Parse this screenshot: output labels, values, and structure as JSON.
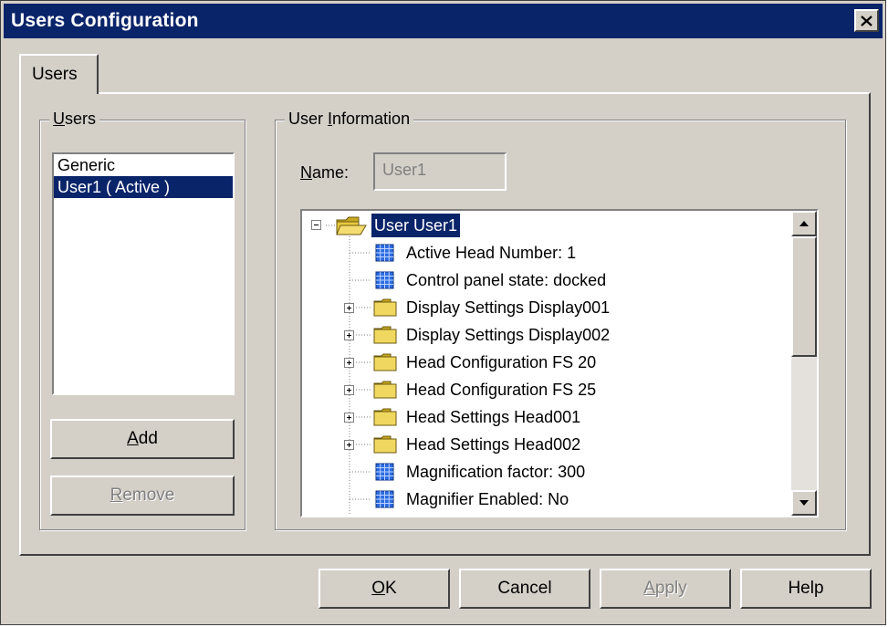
{
  "window": {
    "title": "Users Configuration"
  },
  "tabs": [
    {
      "label": "Users",
      "active": true
    }
  ],
  "users_group": {
    "label_mnemonic": "U",
    "label_rest": "sers",
    "items": [
      {
        "label": "Generic",
        "selected": false
      },
      {
        "label": "User1 ( Active )",
        "selected": true
      }
    ],
    "add_mnemonic": "A",
    "add_rest": "dd",
    "remove_mnemonic": "R",
    "remove_rest": "emove"
  },
  "user_info": {
    "label_pre": "User ",
    "label_mnemonic": "I",
    "label_rest": "nformation",
    "name_label_mnemonic": "N",
    "name_label_rest": "ame:",
    "name_value": "User1"
  },
  "tree": {
    "root": "User User1",
    "items": [
      {
        "label": "Active Head Number: 1",
        "icon": "setting-icon",
        "expandable": false
      },
      {
        "label": "Control panel state: docked",
        "icon": "setting-icon",
        "expandable": false
      },
      {
        "label": "Display Settings Display001",
        "icon": "folder-icon",
        "expandable": true
      },
      {
        "label": "Display Settings Display002",
        "icon": "folder-icon",
        "expandable": true
      },
      {
        "label": "Head Configuration FS 20",
        "icon": "folder-icon",
        "expandable": true
      },
      {
        "label": "Head Configuration FS 25",
        "icon": "folder-icon",
        "expandable": true
      },
      {
        "label": "Head Settings Head001",
        "icon": "folder-icon",
        "expandable": true
      },
      {
        "label": "Head Settings Head002",
        "icon": "folder-icon",
        "expandable": true
      },
      {
        "label": "Magnification factor: 300",
        "icon": "setting-icon",
        "expandable": false
      },
      {
        "label": "Magnifier Enabled: No",
        "icon": "setting-icon",
        "expandable": false
      }
    ]
  },
  "buttons": {
    "ok_mnemonic": "O",
    "ok_rest": "K",
    "cancel": "Cancel",
    "apply_mnemonic": "A",
    "apply_rest": "pply",
    "help": "Help"
  },
  "colors": {
    "titlebar": "#0a246a",
    "face": "#d4d0c8",
    "selection": "#0a246a",
    "folder": "#f0d860",
    "setting_icon": "#2c6be0"
  }
}
